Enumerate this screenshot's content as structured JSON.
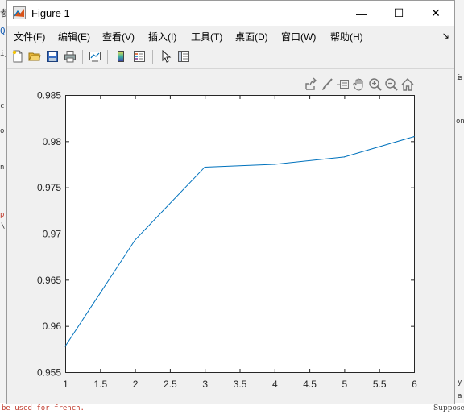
{
  "window": {
    "title": "Figure 1",
    "minimize_glyph": "—",
    "maximize_glyph": "☐",
    "close_glyph": "✕"
  },
  "menu": {
    "items": [
      {
        "label": "文件(F)"
      },
      {
        "label": "编辑(E)"
      },
      {
        "label": "查看(V)"
      },
      {
        "label": "插入(I)"
      },
      {
        "label": "工具(T)"
      },
      {
        "label": "桌面(D)"
      },
      {
        "label": "窗口(W)"
      },
      {
        "label": "帮助(H)"
      }
    ],
    "overflow_glyph": "↘"
  },
  "toolbar": {
    "buttons": [
      "new-figure-icon",
      "open-file-icon",
      "save-icon",
      "print-icon",
      "link-plot-icon",
      "insert-colorbar-icon",
      "insert-legend-icon",
      "edit-plot-arrow-icon",
      "property-inspector-icon"
    ]
  },
  "axes_toolbar": {
    "buttons": [
      "export-icon",
      "brush-icon",
      "datatip-icon",
      "pan-icon",
      "zoom-in-icon",
      "zoom-out-icon",
      "home-icon"
    ]
  },
  "background": {
    "left_fragments": [
      "参",
      "Q",
      "ij",
      "c",
      "o",
      "n",
      "p",
      "\\"
    ],
    "right_fragments": [
      "i",
      "s",
      "on",
      "y",
      "a",
      "Suppose"
    ],
    "bottom_text": "be used for french."
  },
  "colors": {
    "line": "#0072bd",
    "axes_bg": "#ffffff",
    "figure_bg": "#f0f0f0"
  },
  "chart_data": {
    "type": "line",
    "x": [
      1,
      2,
      3,
      4,
      5,
      6
    ],
    "y": [
      0.9578,
      0.9693,
      0.9772,
      0.9775,
      0.9783,
      0.9805
    ],
    "xlim": [
      1,
      6
    ],
    "ylim": [
      0.955,
      0.985
    ],
    "xticks": [
      "1",
      "1.5",
      "2",
      "2.5",
      "3",
      "3.5",
      "4",
      "4.5",
      "5",
      "5.5",
      "6"
    ],
    "yticks": [
      "0.955",
      "0.96",
      "0.965",
      "0.97",
      "0.975",
      "0.98",
      "0.985"
    ],
    "title": "",
    "xlabel": "",
    "ylabel": "",
    "grid": false
  }
}
